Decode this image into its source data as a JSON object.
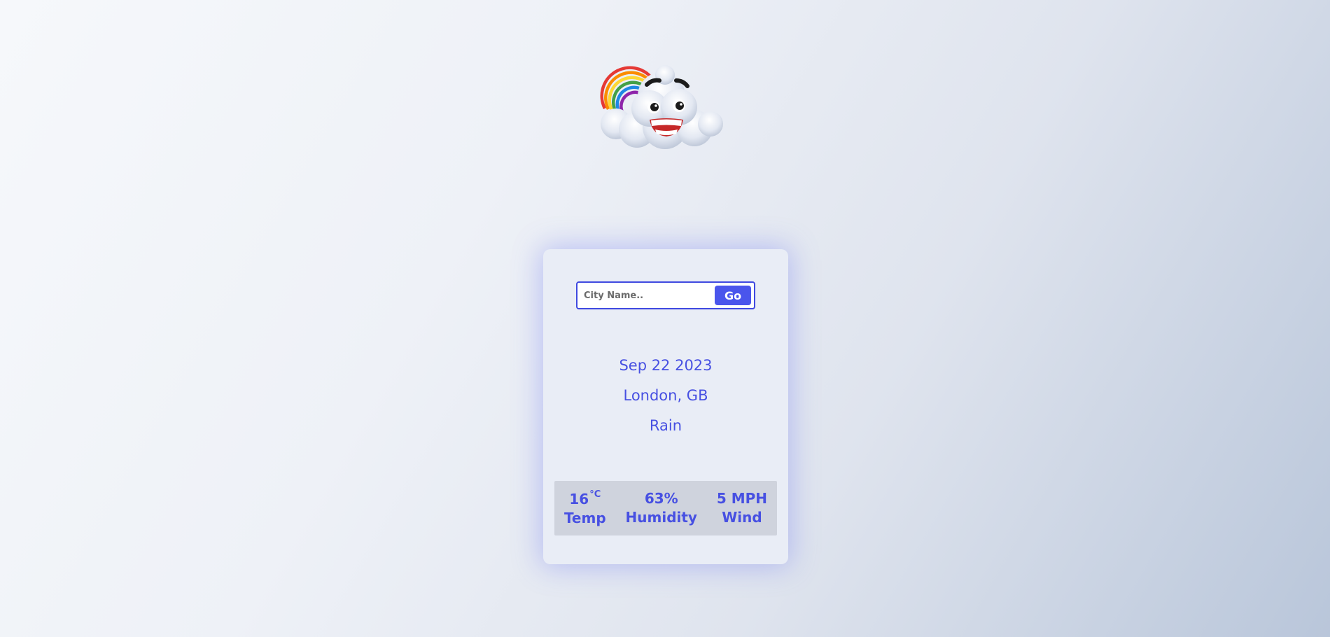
{
  "search": {
    "placeholder": "City Name..",
    "value": "",
    "button_label": "Go"
  },
  "weather": {
    "date": "Sep 22 2023",
    "location": "London, GB",
    "condition": "Rain"
  },
  "stats": {
    "temp": {
      "value": "16",
      "unit": "°C",
      "label": "Temp"
    },
    "humidity": {
      "value": "63%",
      "label": "Humidity"
    },
    "wind": {
      "value": "5 MPH",
      "label": "Wind"
    }
  },
  "icons": {
    "logo": "cloud-rainbow-mascot-icon"
  },
  "colors": {
    "accent": "#4750e2",
    "button": "#4a55ec",
    "card_bg": "#e9edf6",
    "stats_bg": "#cfd3dd"
  }
}
